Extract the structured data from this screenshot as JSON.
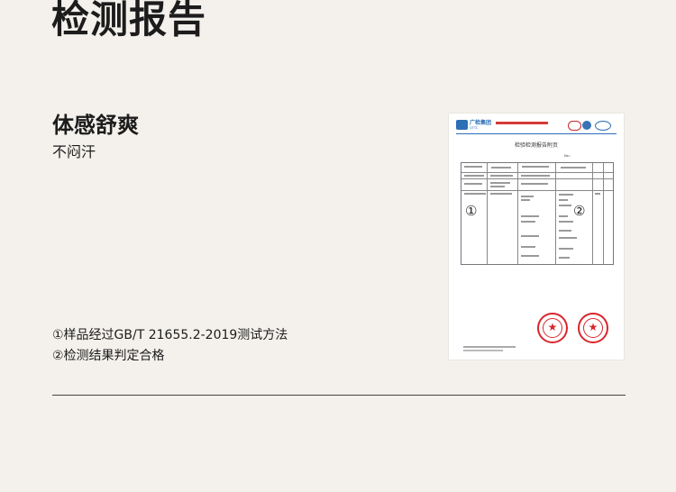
{
  "header": {
    "title": "检测报告"
  },
  "feature": {
    "title": "体感舒爽",
    "subtitle": "不闷汗"
  },
  "notes": [
    "①样品经过GB/T 21655.2-2019测试方法",
    "②检测结果判定合格"
  ],
  "report": {
    "issuer_name": "广检集团",
    "issuer_abbr": "QTTC",
    "title": "检验检测报告附页",
    "report_no": "No.:",
    "markers": [
      "①",
      "②"
    ],
    "seal_icon": "seal-stamp-icon",
    "brand_color": "#2c6fb5",
    "seal_color": "#d8262c"
  },
  "colors": {
    "background": "#f4f1ec",
    "text": "#1c1c1c"
  }
}
